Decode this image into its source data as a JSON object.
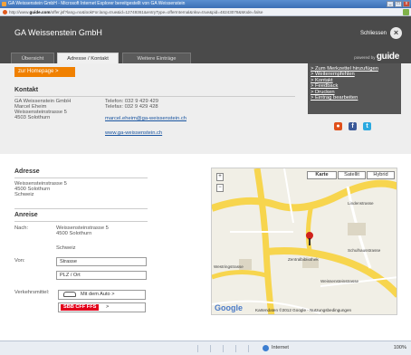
{
  "window": {
    "title": "GA Weissenstein GmbH - Microsoft Internet Explorer bereitgestellt von GA Weissenstein",
    "url_prefix": "http://www.",
    "url_domain": "guide.com",
    "url_rest": "/offer.jsf?lang=no&lookFor.lang=true&id=12749361&entryType=offerInternal&nkw=true&pid=48243078&Mode=false",
    "controls": {
      "minimize": "_",
      "maximize": "□",
      "close": "x"
    }
  },
  "header": {
    "title": "GA Weissenstein GmbH",
    "close_label": "Schliessen",
    "close_symbol": "×"
  },
  "tabs": [
    {
      "label": "Übersicht"
    },
    {
      "label": "Adresse / Kontakt"
    },
    {
      "label": "Weitere Einträge"
    }
  ],
  "powered": {
    "prefix": "powered by",
    "brand": "guide"
  },
  "homepage_button": "zur Homepage >",
  "kontakt": {
    "title": "Kontakt",
    "address_lines": [
      "GA Weissenstein GmbH",
      "Marcel Eheim",
      "Weissensteinstrasse 5",
      "4503 Solothurn"
    ],
    "telefon": "Telefon: 032 9 429 429",
    "telefax": "Telefax: 032 9 429 428",
    "email": "marcel.eheim@ga-weissenstein.ch",
    "website": "www.ga-weissenstein.ch"
  },
  "sidebox": {
    "links": [
      "> Zum Merkzettel hinzufügen",
      "> Weiterempfehlen",
      "> Kontakt",
      "> Feedback",
      "> Drucken",
      "> Eintrag bearbeiten"
    ]
  },
  "share_icons": [
    {
      "name": "swiss-icon",
      "glyph": "●",
      "color": "#e0501a"
    },
    {
      "name": "facebook-icon",
      "glyph": "f",
      "color": "#3b5998"
    },
    {
      "name": "twitter-icon",
      "glyph": "t",
      "color": "#2aa9e0"
    }
  ],
  "adresse": {
    "title": "Adresse",
    "lines": [
      "Weissensteinstrasse 5",
      "4500 Solothurn",
      "Schweiz"
    ]
  },
  "anreise": {
    "title": "Anreise",
    "nach_label": "Nach:",
    "nach_lines": [
      "Weissensteinstrasse 5",
      "4500 Solothurn"
    ],
    "nach_country": "Schweiz",
    "von_label": "Von:",
    "street_placeholder": "Strasse",
    "city_placeholder": "PLZ / Ort",
    "transport_label": "Verkehrsmittel:",
    "car_button": "Mit dem Auto >",
    "sbb_badge": "SBB CFF FFS",
    "sbb_arrow": ">"
  },
  "map": {
    "types": [
      "Karte",
      "Satellit",
      "Hybrid"
    ],
    "zoom_in": "+",
    "zoom_out": "−",
    "labels": [
      "Zentralbibliothek",
      "Schulhausstrasse",
      "Weissensteinstrasse",
      "Lindenstrasse",
      "Westringstrasse"
    ],
    "google": "Google",
    "copyright": "Kartendaten ©2012 Google - Nutzungsbedingungen"
  },
  "statusbar": {
    "zone": "Internet",
    "zoom": "100%"
  }
}
